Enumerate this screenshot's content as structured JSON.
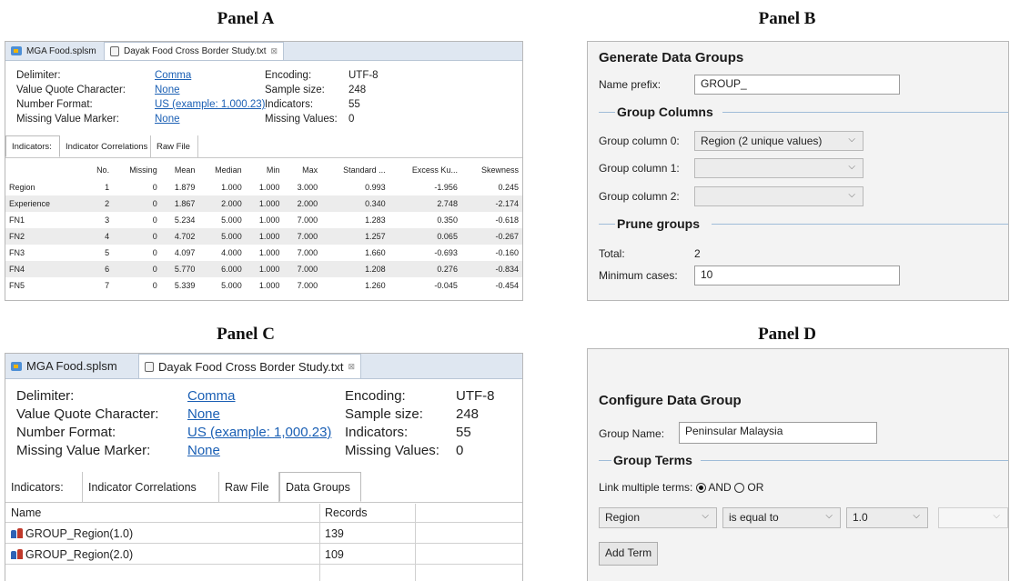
{
  "panel_titles": {
    "a": "Panel A",
    "b": "Panel B",
    "c": "Panel C",
    "d": "Panel D"
  },
  "tabs": {
    "mga": "MGA Food.splsm",
    "dataset": "Dayak Food Cross Border Study.txt",
    "close": "⊠"
  },
  "file_info": {
    "delimiter_label": "Delimiter:",
    "delimiter_value": "Comma",
    "quote_label": "Value Quote Character:",
    "quote_value": "None",
    "number_label": "Number Format:",
    "number_value": "US (example: 1,000.23)",
    "missing_label": "Missing Value Marker:",
    "missing_value": "None",
    "encoding_label": "Encoding:",
    "encoding_value": "UTF-8",
    "sample_label": "Sample size:",
    "sample_value": "248",
    "indicators_label": "Indicators:",
    "indicators_value": "55",
    "missingvals_label": "Missing Values:",
    "missingvals_value": "0"
  },
  "subtabs_a": [
    "Indicators:",
    "Indicator Correlations",
    "Raw File"
  ],
  "subtabs_c": [
    "Indicators:",
    "Indicator Correlations",
    "Raw File",
    "Data Groups"
  ],
  "indicator_table": {
    "columns": [
      "",
      "No.",
      "Missing",
      "Mean",
      "Median",
      "Min",
      "Max",
      "Standard ...",
      "Excess Ku...",
      "Skewness"
    ],
    "rows": [
      [
        "Region",
        "1",
        "0",
        "1.879",
        "1.000",
        "1.000",
        "3.000",
        "0.993",
        "-1.956",
        "0.245"
      ],
      [
        "Experience",
        "2",
        "0",
        "1.867",
        "2.000",
        "1.000",
        "2.000",
        "0.340",
        "2.748",
        "-2.174"
      ],
      [
        "FN1",
        "3",
        "0",
        "5.234",
        "5.000",
        "1.000",
        "7.000",
        "1.283",
        "0.350",
        "-0.618"
      ],
      [
        "FN2",
        "4",
        "0",
        "4.702",
        "5.000",
        "1.000",
        "7.000",
        "1.257",
        "0.065",
        "-0.267"
      ],
      [
        "FN3",
        "5",
        "0",
        "4.097",
        "4.000",
        "1.000",
        "7.000",
        "1.660",
        "-0.693",
        "-0.160"
      ],
      [
        "FN4",
        "6",
        "0",
        "5.770",
        "6.000",
        "1.000",
        "7.000",
        "1.208",
        "0.276",
        "-0.834"
      ],
      [
        "FN5",
        "7",
        "0",
        "5.339",
        "5.000",
        "1.000",
        "7.000",
        "1.260",
        "-0.045",
        "-0.454"
      ]
    ]
  },
  "generate_groups": {
    "title": "Generate Data Groups",
    "prefix_label": "Name prefix:",
    "prefix_value": "GROUP_",
    "group_columns_head": "Group Columns",
    "col0_label": "Group column 0:",
    "col0_value": "Region (2 unique values)",
    "col1_label": "Group column 1:",
    "col1_value": "",
    "col2_label": "Group column 2:",
    "col2_value": "",
    "prune_head": "Prune groups",
    "total_label": "Total:",
    "total_value": "2",
    "min_label": "Minimum cases:",
    "min_value": "10"
  },
  "data_groups": {
    "name_header": "Name",
    "records_header": "Records",
    "rows": [
      {
        "name": "GROUP_Region(1.0)",
        "records": "139"
      },
      {
        "name": "GROUP_Region(2.0)",
        "records": "109"
      }
    ]
  },
  "configure_group": {
    "title": "Configure Data Group",
    "name_label": "Group Name:",
    "name_value": "Peninsular Malaysia",
    "terms_head": "Group Terms",
    "link_label": "Link multiple terms:",
    "and_label": "AND",
    "or_label": "OR",
    "term_column": "Region",
    "term_operator": "is equal to",
    "term_value": "1.0",
    "term_extra": "",
    "add_term": "Add Term"
  },
  "icons": [
    "mga-project-icon",
    "dataset-file-icon",
    "group-icon",
    "chevron-down-icon",
    "radio-icon"
  ]
}
